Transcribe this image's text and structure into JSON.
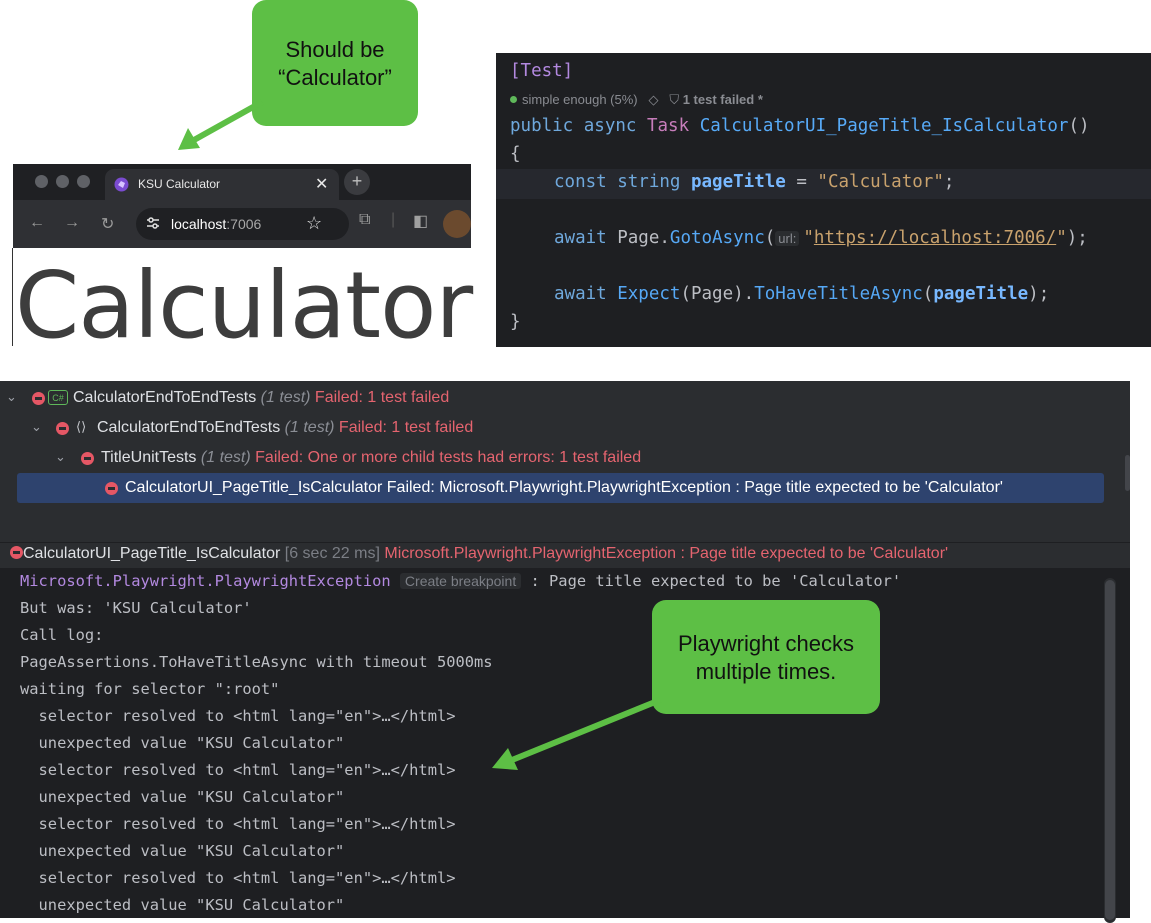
{
  "callouts": {
    "top": "Should be “Calculator”",
    "bottom": "Playwright checks multiple times."
  },
  "browser": {
    "tab_title": "KSU Calculator",
    "url_host": "localhost",
    "url_port": ":7006",
    "page_heading": "Calculator"
  },
  "code": {
    "attribute": "[Test]",
    "meta_coverage": "simple enough (5%)",
    "meta_status": "1 test failed *",
    "line_signature_kw": "public async",
    "line_signature_type": "Task",
    "line_signature_name": "CalculatorUI_PageTitle_IsCalculator",
    "line_signature_parens": "()",
    "open_brace": "{",
    "close_brace": "}",
    "l1_const": "const string",
    "l1_var": "pageTitle",
    "l1_eq": " = ",
    "l1_str": "\"Calculator\"",
    "l1_end": ";",
    "l2_await": "await",
    "l2_obj": " Page.",
    "l2_method": "GotoAsync",
    "l2_open": "(",
    "l2_hint": "url:",
    "l2_q1": "\"",
    "l2_url": "https://localhost:7006/",
    "l2_q2": "\"",
    "l2_end": ");",
    "l3_await": "await",
    "l3_method1": " Expect",
    "l3_mid": "(Page).",
    "l3_method2": "ToHaveTitleAsync",
    "l3_open": "(",
    "l3_arg": "pageTitle",
    "l3_end": ");"
  },
  "tests": {
    "rows": [
      {
        "name": "CalculatorEndToEndTests",
        "count": "(1 test)",
        "status": "Failed: 1 test failed"
      },
      {
        "name": "CalculatorEndToEndTests",
        "count": "(1 test)",
        "status": "Failed: 1 test failed"
      },
      {
        "name": "TitleUnitTests",
        "count": "(1 test)",
        "status": "Failed: One or more child tests had errors: 1 test failed"
      },
      {
        "name": "CalculatorUI_PageTitle_IsCalculator",
        "status": "Failed: Microsoft.Playwright.PlaywrightException : Page title expected to be 'Calculator'"
      }
    ],
    "output_header": {
      "name": "CalculatorUI_PageTitle_IsCalculator",
      "duration": "[6 sec 22 ms]",
      "error": "Microsoft.Playwright.PlaywrightException : Page title expected to be 'Calculator'"
    },
    "console": {
      "exception": "Microsoft.Playwright.PlaywrightException",
      "breakpoint": "Create breakpoint",
      "exception_msg": ": Page title expected to be 'Calculator'",
      "lines": [
        "But was: 'KSU Calculator'",
        "Call log:",
        "PageAssertions.ToHaveTitleAsync with timeout 5000ms",
        "waiting for selector \":root\"",
        "  selector resolved to <html lang=\"en\">…</html>",
        "  unexpected value \"KSU Calculator\"",
        "  selector resolved to <html lang=\"en\">…</html>",
        "  unexpected value \"KSU Calculator\"",
        "  selector resolved to <html lang=\"en\">…</html>",
        "  unexpected value \"KSU Calculator\"",
        "  selector resolved to <html lang=\"en\">…</html>",
        "  unexpected value \"KSU Calculator\""
      ]
    }
  },
  "colors": {
    "callout": "#5dbf45",
    "fail": "#e5646f",
    "selection": "#2e436e"
  }
}
